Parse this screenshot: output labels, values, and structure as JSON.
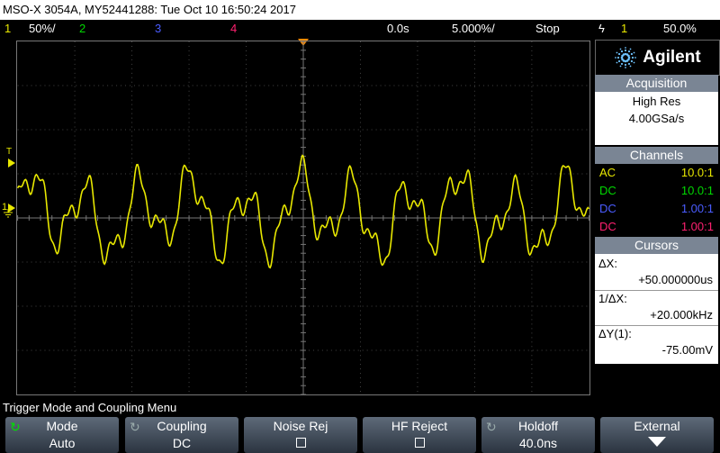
{
  "title_bar": "MSO-X 3054A, MY52441288: Tue Oct 10 16:50:24 2017",
  "status_bar": {
    "ch1_num": "1",
    "ch1_scale": "50%/",
    "ch2_num": "2",
    "ch3_num": "3",
    "ch4_num": "4",
    "time_delay": "0.0s",
    "time_base": "5.000%/",
    "run_state": "Stop",
    "trigger_icon": "ϟ",
    "trigger_src": "1",
    "trigger_level": "50.0%"
  },
  "markers": {
    "trigger_level": "T",
    "ground": "1"
  },
  "logo": {
    "text": "Agilent",
    "icon": "agilent-spark-icon"
  },
  "acquisition": {
    "header": "Acquisition",
    "mode": "High Res",
    "rate": "4.00GSa/s"
  },
  "channels": {
    "header": "Channels",
    "rows": [
      {
        "coupling": "AC",
        "probe": "10.0:1",
        "color": "#e8e800"
      },
      {
        "coupling": "DC",
        "probe": "10.0:1",
        "color": "#00d800"
      },
      {
        "coupling": "DC",
        "probe": "1.00:1",
        "color": "#4a5cff"
      },
      {
        "coupling": "DC",
        "probe": "1.00:1",
        "color": "#ff2070"
      }
    ]
  },
  "cursors": {
    "header": "Cursors",
    "dx_label": "ΔX:",
    "dx_value": "+50.000000us",
    "inv_label": "1/ΔX:",
    "inv_value": "+20.000kHz",
    "dy_label": "ΔY(1):",
    "dy_value": "-75.00mV"
  },
  "menu_title": "Trigger Mode and Coupling Menu",
  "softkeys": [
    {
      "label": "Mode",
      "value": "Auto"
    },
    {
      "label": "Coupling",
      "value": "DC"
    },
    {
      "label": "Noise Rej",
      "value": ""
    },
    {
      "label": "HF Reject",
      "value": ""
    },
    {
      "label": "Holdoff",
      "value": "40.0ns"
    },
    {
      "label": "External",
      "value": ""
    }
  ],
  "colors": {
    "ch1": "#e8e800",
    "ch2": "#00d800",
    "ch3": "#4a5cff",
    "ch4": "#ff2070",
    "trigger_marker": "#ff8c00",
    "panel_header": "#7a8594"
  }
}
